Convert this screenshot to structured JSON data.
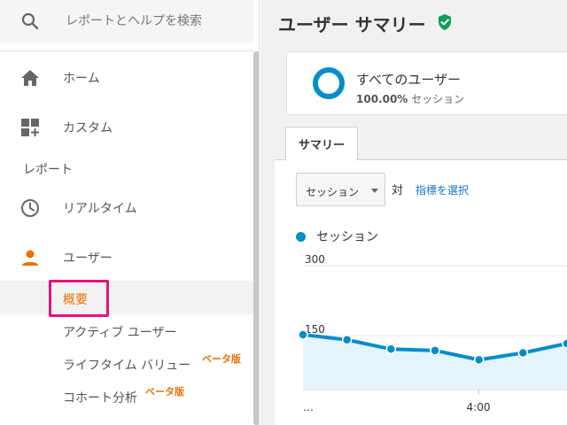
{
  "sidebar": {
    "search_placeholder": "レポートとヘルプを検索",
    "nav": [
      {
        "label": "ホーム",
        "icon": "home-icon"
      },
      {
        "label": "カスタム",
        "icon": "dashboard-add-icon"
      }
    ],
    "section_label": "レポート",
    "reports": [
      {
        "label": "リアルタイム",
        "icon": "clock-icon"
      },
      {
        "label": "ユーザー",
        "icon": "person-icon"
      }
    ],
    "user_subitems": [
      {
        "label": "概要",
        "active": true
      },
      {
        "label": "アクティブ ユーザー"
      },
      {
        "label": "ライフタイム バリュー",
        "badge": "ベータ版"
      },
      {
        "label": "コホート分析",
        "badge": "ベータ版"
      }
    ]
  },
  "main": {
    "title": "ユーザー サマリー",
    "segment": {
      "name": "すべてのユーザー",
      "percent": "100.00%",
      "percent_unit": "セッション"
    },
    "tab": "サマリー",
    "metric_select_value": "セッション",
    "vs_label": "対",
    "choose_metric_label": "指標を選択",
    "legend_label": "セッション"
  },
  "colors": {
    "accent_orange": "#e8710a",
    "highlight_pink": "#e6117d",
    "series_blue": "#058dc7",
    "verified_green": "#0f9d58"
  },
  "chart_data": {
    "type": "line",
    "series": [
      {
        "name": "セッション",
        "values": [
          152,
          141,
          121,
          118,
          98,
          113,
          133
        ]
      }
    ],
    "x_tick_labels": [
      "…",
      "4:00"
    ],
    "y_ticks": [
      300,
      150
    ],
    "ylim": [
      0,
      300
    ]
  }
}
